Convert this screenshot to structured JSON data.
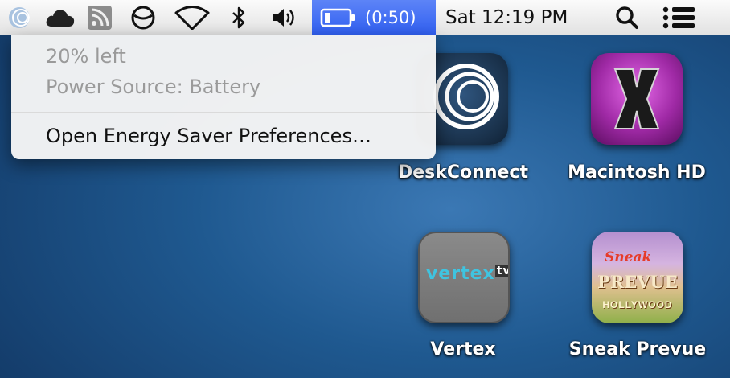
{
  "menubar": {
    "icons": [
      "deskconnect-icon",
      "cloud-icon",
      "rss-icon",
      "sync-icon",
      "wifi-icon",
      "bluetooth-icon",
      "volume-icon"
    ],
    "battery_time": "(0:50)",
    "clock": "Sat 12:19 PM",
    "highlight_color": "#3a66f2"
  },
  "battery_menu": {
    "charge": "20% left",
    "power_source": "Power Source: Battery",
    "action": "Open Energy Saver Preferences…"
  },
  "desktop": {
    "icons": [
      {
        "label": "DeskConnect",
        "icon": "deskconnect-app-icon"
      },
      {
        "label": "Macintosh HD",
        "icon": "macintosh-hd-icon"
      },
      {
        "label": "Vertex",
        "icon": "vertex-app-icon",
        "logo_text": "vertex",
        "logo_suffix": "tv"
      },
      {
        "label": "Sneak Prevue",
        "icon": "sneak-prevue-app-icon",
        "logo_text": [
          "Sneak",
          "PREVUE",
          "HOLLYWOOD"
        ]
      }
    ]
  }
}
